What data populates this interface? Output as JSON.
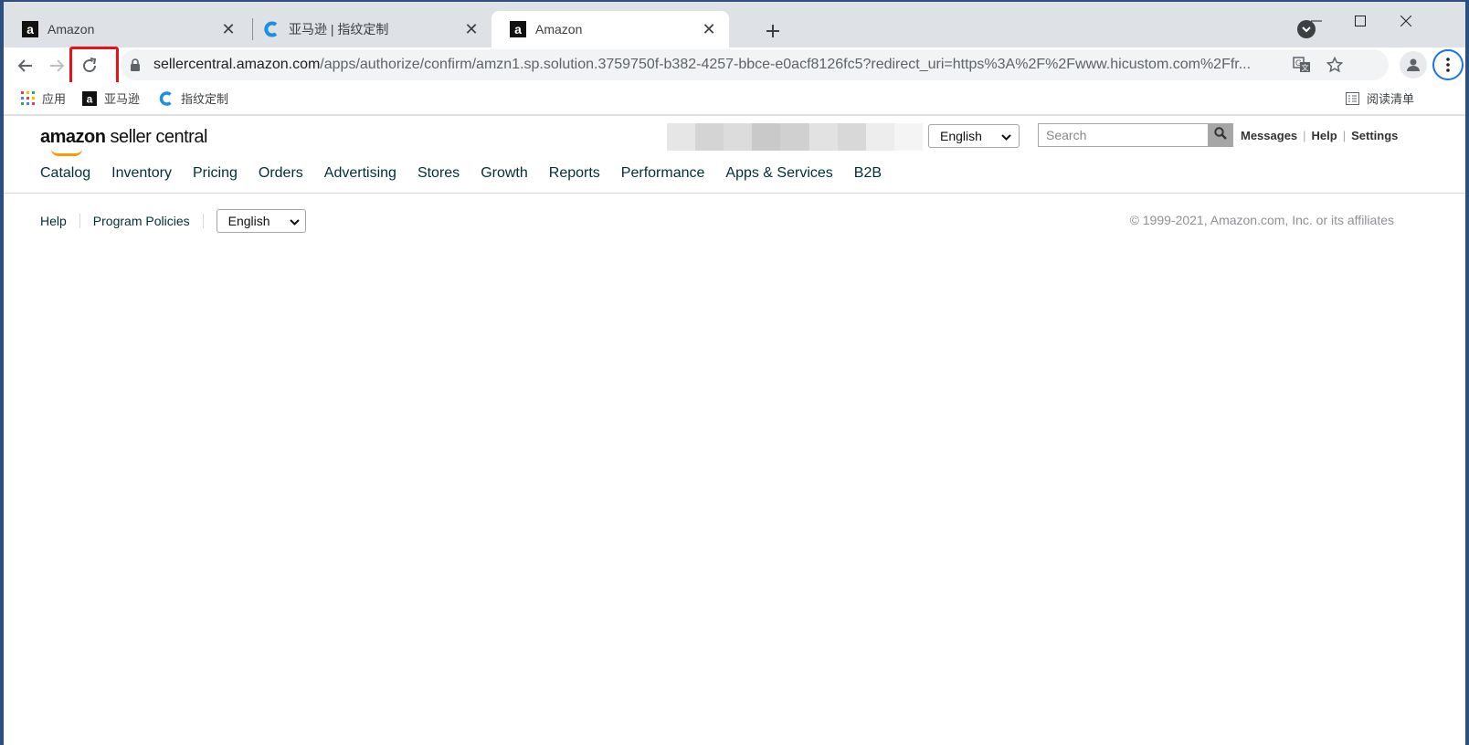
{
  "tabs": [
    {
      "title": "Amazon",
      "favicon": "amazon-a-icon"
    },
    {
      "title": "亚马逊 | 指纹定制",
      "favicon": "c-logo-icon"
    },
    {
      "title": "Amazon",
      "favicon": "amazon-a-icon"
    }
  ],
  "address_bar": {
    "url_host": "sellercentral.amazon.com",
    "url_path": "/apps/authorize/confirm/amzn1.sp.solution.3759750f-b382-4257-bbce-e0acf8126fc5?redirect_uri=https%3A%2F%2Fwww.hicustom.com%2Ffr..."
  },
  "bookmarks": [
    {
      "label": "应用",
      "icon": "apps-grid-icon"
    },
    {
      "label": "亚马逊",
      "icon": "amazon-a-icon"
    },
    {
      "label": "指纹定制",
      "icon": "c-logo-icon"
    }
  ],
  "reading_list": "阅读清单",
  "header": {
    "logo_bold": "amazon",
    "logo_rest": " seller central",
    "language": "English",
    "search_placeholder": "Search",
    "links": [
      "Messages",
      "Help",
      "Settings"
    ]
  },
  "nav": [
    "Catalog",
    "Inventory",
    "Pricing",
    "Orders",
    "Advertising",
    "Stores",
    "Growth",
    "Reports",
    "Performance",
    "Apps & Services",
    "B2B"
  ],
  "footer": {
    "links": [
      "Help",
      "Program Policies"
    ],
    "language": "English",
    "copyright": "© 1999-2021, Amazon.com, Inc. or its affiliates"
  },
  "colors": {
    "accent": "#1a73e8",
    "highlight": "#e8121b",
    "amazon_orange": "#ff9900"
  }
}
